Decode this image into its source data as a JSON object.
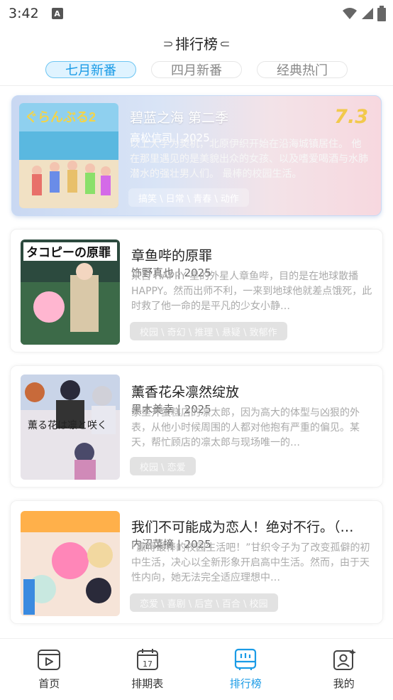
{
  "status": {
    "time": "3:42",
    "a_label": "A"
  },
  "header": {
    "title": "⸧排行榜⸦"
  },
  "tabs": [
    {
      "label": "七月新番",
      "active": true
    },
    {
      "label": "四月新番",
      "active": false
    },
    {
      "label": "经典热门",
      "active": false
    }
  ],
  "items": [
    {
      "title": "碧蓝之海 第二季",
      "meta": "高松信司 | 2025",
      "score": "7.3",
      "desc": "以上大学为契机，北原伊织开始在沿海城镇居住。 他在那里遇见的是美貌出众的女孩、以及嗜爱喝酒与水肺潜水的强壮男人们。 最棒的校园生活。",
      "tags": "搞笑 \\ 日常 \\ 青春 \\ 动作"
    },
    {
      "title": "章鱼哔的原罪",
      "meta": "饰野真也 | 2025",
      "desc": "来自 HAPPY 星的外星人章鱼哔，目的是在地球散播 HAPPY。然而出师不利，一来到地球他就差点饿死，此时救了他一命的是平凡的少女小静…",
      "tags": "校园 \\ 奇幻 \\ 推理 \\ 悬疑 \\ 致郁作"
    },
    {
      "title": "薰香花朵凛然绽放",
      "meta": "黑木美幸 | 2025",
      "desc": "家里开蛋糕店的凛太郎，因为高大的体型与凶狠的外表，从他小时候周围的人都对他抱有严重的偏见。某天，帮忙顾店的凛太郎与现场唯一的…",
      "tags": "校园 \\ 恋爱"
    },
    {
      "title": "我们不可能成为恋人！绝对不行。（…",
      "meta": "内沼菜摘 | 2025",
      "desc": "“赢得最棒的校园生活吧！”甘织令子为了改变孤僻的初中生活，决心以全新形象开启高中生活。然而，由于天性内向，她无法完全适应理想中…",
      "tags": "恋爱 \\ 喜剧 \\ 后宫 \\ 百合 \\ 校园"
    }
  ],
  "nav": [
    {
      "label": "首页",
      "icon": "play-icon",
      "active": false
    },
    {
      "label": "排期表",
      "icon": "calendar-icon",
      "active": false,
      "day": "17"
    },
    {
      "label": "排行榜",
      "icon": "ranking-icon",
      "active": true
    },
    {
      "label": "我的",
      "icon": "profile-icon",
      "active": false
    }
  ],
  "colors": {
    "accent": "#1a9be6",
    "score": "#f2c94c"
  }
}
